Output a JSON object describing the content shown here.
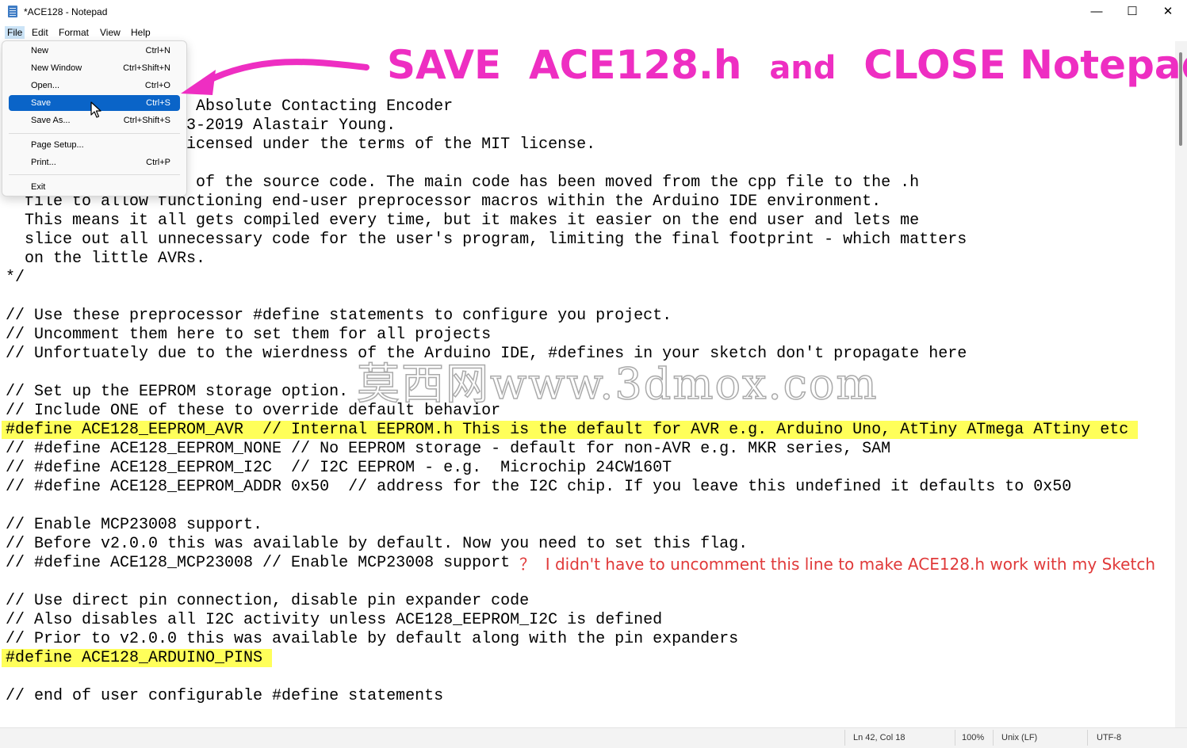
{
  "window": {
    "title": "*ACE128 - Notepad",
    "minimize_glyph": "—",
    "maximize_glyph": "☐",
    "close_glyph": "✕"
  },
  "menubar": [
    "File",
    "Edit",
    "Format",
    "View",
    "Help"
  ],
  "file_menu": [
    {
      "label": "New",
      "accel": "Ctrl+N"
    },
    {
      "label": "New Window",
      "accel": "Ctrl+Shift+N"
    },
    {
      "label": "Open...",
      "accel": "Ctrl+O"
    },
    {
      "label": "Save",
      "accel": "Ctrl+S",
      "selected": true
    },
    {
      "label": "Save As...",
      "accel": "Ctrl+Shift+S"
    },
    {
      "label": "Page Setup...",
      "accel": ""
    },
    {
      "label": "Print...",
      "accel": "Ctrl+P"
    },
    {
      "label": "Exit",
      "accel": ""
    }
  ],
  "editor": {
    "lines": [
      {
        "text": "                    Absolute Contacting Encoder"
      },
      {
        "text": "                   3-2019 Alastair Young."
      },
      {
        "text": "                   icensed under the terms of the MIT license."
      },
      {
        "text": ""
      },
      {
        "text": "                    of the source code. The main code has been moved from the cpp file to the .h"
      },
      {
        "text": "  file to allow functioning end-user preprocessor macros within the Arduino IDE environment."
      },
      {
        "text": "  This means it all gets compiled every time, but it makes it easier on the end user and lets me"
      },
      {
        "text": "  slice out all unnecessary code for the user's program, limiting the final footprint - which matters"
      },
      {
        "text": "  on the little AVRs."
      },
      {
        "text": "*/"
      },
      {
        "text": ""
      },
      {
        "text": "// Use these preprocessor #define statements to configure you project."
      },
      {
        "text": "// Uncomment them here to set them for all projects"
      },
      {
        "text": "// Unfortuately due to the wierdness of the Arduino IDE, #defines in your sketch don't propagate here"
      },
      {
        "text": ""
      },
      {
        "text": "// Set up the EEPROM storage option."
      },
      {
        "text": "// Include ONE of these to override default behavior"
      },
      {
        "text": "#define ACE128_EEPROM_AVR  // Internal EEPROM.h This is the default for AVR e.g. Arduino Uno, AtTiny ATmega ATtiny etc ",
        "highlight": true
      },
      {
        "text": "// #define ACE128_EEPROM_NONE // No EEPROM storage - default for non-AVR e.g. MKR series, SAM"
      },
      {
        "text": "// #define ACE128_EEPROM_I2C  // I2C EEPROM - e.g.  Microchip 24CW160T"
      },
      {
        "text": "// #define ACE128_EEPROM_ADDR 0x50  // address for the I2C chip. If you leave this undefined it defaults to 0x50"
      },
      {
        "text": ""
      },
      {
        "text": "// Enable MCP23008 support."
      },
      {
        "text": "// Before v2.0.0 this was available by default. Now you need to set this flag."
      },
      {
        "text": "// #define ACE128_MCP23008 // Enable MCP23008 support"
      },
      {
        "text": ""
      },
      {
        "text": "// Use direct pin connection, disable pin expander code"
      },
      {
        "text": "// Also disables all I2C activity unless ACE128_EEPROM_I2C is defined"
      },
      {
        "text": "// Prior to v2.0.0 this was available by default along with the pin expanders"
      },
      {
        "text": "#define ACE128_ARDUINO_PINS ",
        "highlight": true
      },
      {
        "text": ""
      },
      {
        "text": "// end of user configurable #define statements"
      }
    ]
  },
  "annotations": {
    "title_part1": "SAVE  ACE128.h  ",
    "title_part2": "and",
    "title_part3": "  CLOSE Notepad",
    "note": "？  I didn't have to uncomment this line to make ACE128.h work with my Sketch",
    "watermark": "莫西网www.3dmox.com",
    "color_pink": "#ee2ec2",
    "color_red": "#e03a3a"
  },
  "statusbar": {
    "position": "Ln 42, Col 18",
    "zoom": "100%",
    "line_ending": "Unix (LF)",
    "encoding": "UTF-8"
  }
}
